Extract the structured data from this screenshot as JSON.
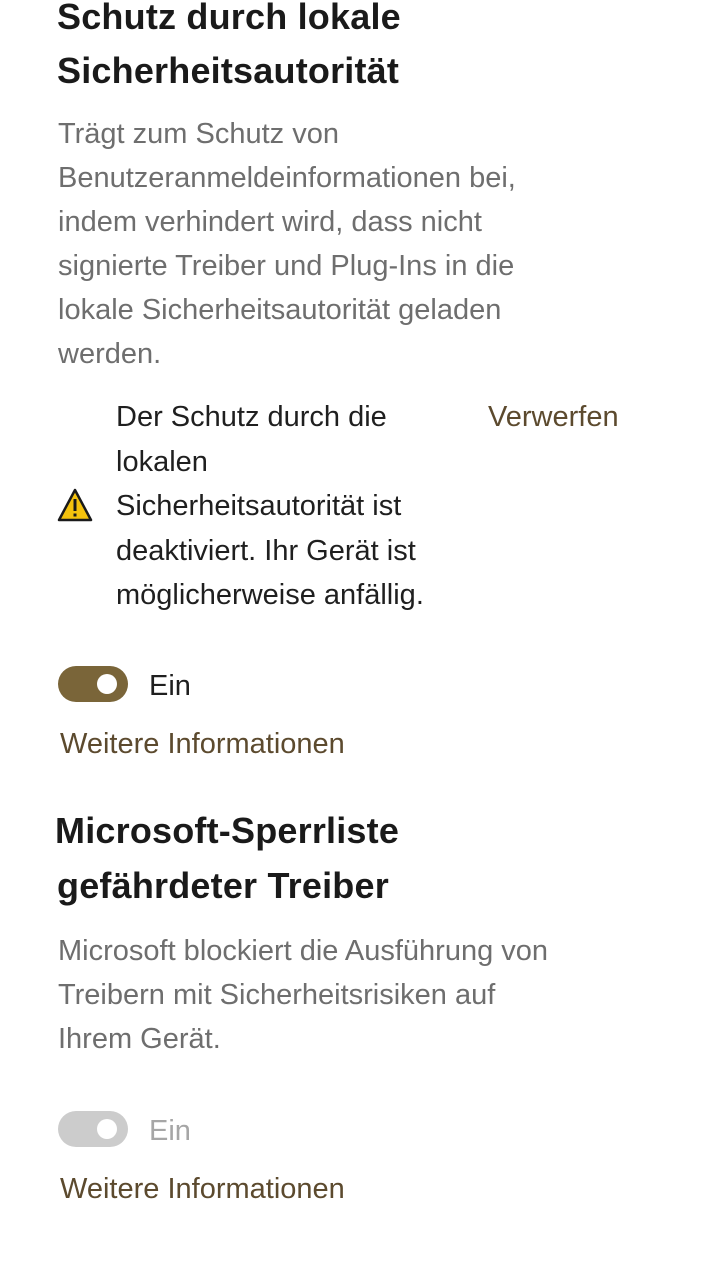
{
  "lsa": {
    "title_line1": "Schutz durch lokale",
    "title_line2": "Sicherheitsautorität",
    "description_lines": [
      "Trägt zum Schutz von",
      "Benutzeranmeldeinformationen bei,",
      "indem verhindert wird, dass nicht",
      "signierte Treiber und Plug-Ins in die",
      "lokale Sicherheitsautorität geladen",
      "werden."
    ],
    "warning": {
      "icon": "warning-icon",
      "lines": [
        "Der Schutz durch die",
        "lokalen",
        "Sicherheitsautorität ist",
        "deaktiviert. Ihr Gerät ist",
        "möglicherweise anfällig."
      ],
      "dismiss_label": "Verwerfen"
    },
    "toggle": {
      "state": "on",
      "label": "Ein",
      "color": "#7a6539"
    },
    "learn_more": "Weitere Informationen"
  },
  "blocklist": {
    "title_line1": "Microsoft-Sperrliste",
    "title_line2": "gefährdeter Treiber",
    "description_lines": [
      "Microsoft blockiert die Ausführung von",
      "Treibern mit Sicherheitsrisiken auf",
      "Ihrem Gerät."
    ],
    "toggle": {
      "state": "on-disabled",
      "label": "Ein",
      "color": "#cccccc"
    },
    "learn_more": "Weitere Informationen"
  }
}
